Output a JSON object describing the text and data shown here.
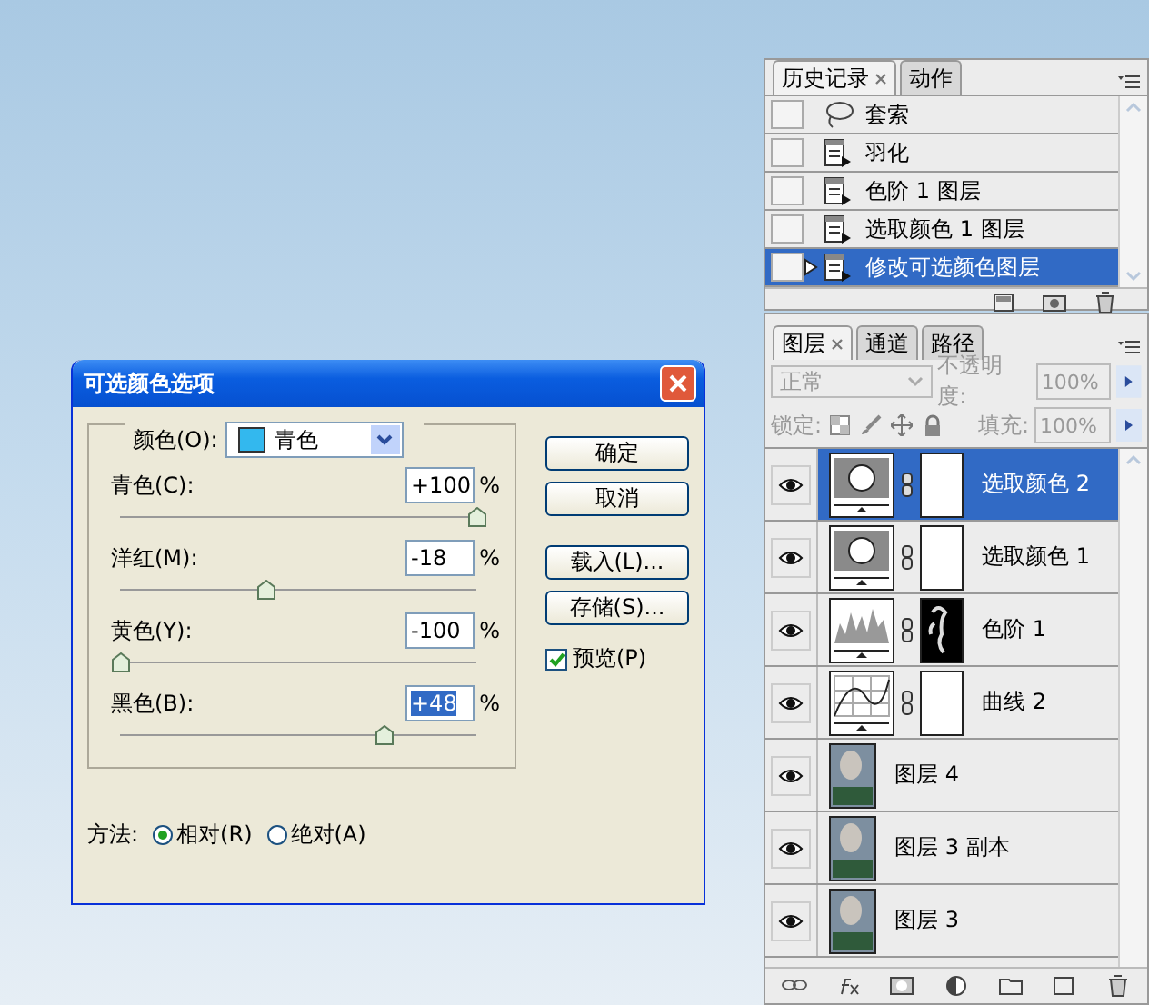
{
  "dialog": {
    "title": "可选颜色选项",
    "color_label": "颜色(O):",
    "color_value": "青色",
    "sliders": [
      {
        "label": "青色(C):",
        "value": "+100",
        "unit": "%",
        "level": 1.0,
        "selected": false
      },
      {
        "label": "洋红(M):",
        "value": "-18",
        "unit": "%",
        "level": 0.41,
        "selected": false
      },
      {
        "label": "黄色(Y):",
        "value": "-100",
        "unit": "%",
        "level": 0.0,
        "selected": false
      },
      {
        "label": "黑色(B):",
        "value": "+48",
        "unit": "%",
        "level": 0.74,
        "selected": true
      }
    ],
    "buttons": [
      "确定",
      "取消",
      "载入(L)...",
      "存储(S)..."
    ],
    "preview": {
      "label": "预览(P)",
      "checked": true
    },
    "method_label": "方法:",
    "methods": [
      {
        "label": "相对(R)",
        "selected": true
      },
      {
        "label": "绝对(A)",
        "selected": false
      }
    ]
  },
  "history": {
    "tabs": [
      {
        "label": "历史记录",
        "selected": true
      },
      {
        "label": "动作",
        "selected": false
      }
    ],
    "items": [
      {
        "kind": "lasso",
        "label": "套索",
        "selected": false
      },
      {
        "kind": "step",
        "label": "羽化",
        "selected": false
      },
      {
        "kind": "step",
        "label": "色阶 1 图层",
        "selected": false
      },
      {
        "kind": "step",
        "label": "选取颜色 1 图层",
        "selected": false
      },
      {
        "kind": "step",
        "label": "修改可选颜色图层",
        "selected": true
      }
    ]
  },
  "layers": {
    "tabs": [
      {
        "label": "图层",
        "selected": true
      },
      {
        "label": "通道",
        "selected": false
      },
      {
        "label": "路径",
        "selected": false
      }
    ],
    "blend_mode": "正常",
    "opacity_label": "不透明度:",
    "opacity": "100%",
    "lock_label": "锁定:",
    "fill_label": "填充:",
    "fill": "100%",
    "items": [
      {
        "kind": "selective",
        "mask": {
          "kind": "white"
        },
        "label": "选取颜色 2",
        "visible": true,
        "selected": true
      },
      {
        "kind": "selective",
        "mask": {
          "kind": "white"
        },
        "label": "选取颜色 1",
        "visible": true,
        "selected": false
      },
      {
        "kind": "levels",
        "mask": {
          "kind": "figure"
        },
        "label": "色阶 1",
        "visible": true,
        "selected": false
      },
      {
        "kind": "curves",
        "mask": {
          "kind": "white"
        },
        "label": "曲线 2",
        "visible": true,
        "selected": false
      },
      {
        "kind": "photo",
        "label": "图层 4",
        "visible": true,
        "selected": false
      },
      {
        "kind": "photo",
        "label": "图层 3 副本",
        "visible": true,
        "selected": false
      },
      {
        "kind": "photo",
        "label": "图层 3",
        "visible": true,
        "selected": false
      }
    ]
  }
}
